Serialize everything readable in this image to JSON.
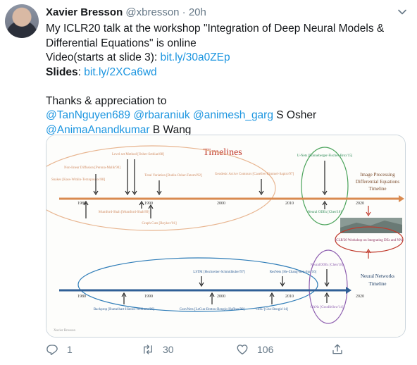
{
  "author": {
    "name": "Xavier Bresson",
    "handle": "@xbresson",
    "time": "20h"
  },
  "tweet": {
    "line1": "My ICLR20 talk at the workshop \"Integration of Deep Neural Models &",
    "line2": "Differential Equations\" is online",
    "video_prefix": "Video(starts at slide 3): ",
    "video_link": "bit.ly/30a0ZEp",
    "slides_label": "Slides",
    "slides_colon": ": ",
    "slides_link": "bit.ly/2XCa6wd",
    "thanks": "Thanks & appreciation to",
    "mention1": "@TanNguyen689",
    "mention2": "@rbaraniuk",
    "mention3": "@animesh_garg",
    "osher": " S Osher",
    "mention4": "@AnimaAnandkumar",
    "wang": " B Wang"
  },
  "slide": {
    "title": "Timelines",
    "top_axis_years": [
      "1980",
      "1990",
      "2000",
      "2010",
      "2020"
    ],
    "bottom_axis_years": [
      "1980",
      "1990",
      "2000",
      "2010",
      "2020"
    ],
    "label_ip": "Image Processing",
    "label_de": "Differential Equations",
    "label_tl": "Timeline",
    "label_nn": "Neural Networks",
    "label_tl2": "Timeline",
    "top_notes": [
      "Level set Method [Osher-Sethian'88]",
      "Non-linear Diffusion [Perona-Malik'90]",
      "Snakes [Kass-Witkin-Terzopoulos'88]",
      "Total Variation [Rudin-Osher-Fatemi'92]",
      "Geodesic Active Contours [Caselles-Kimmel-Sapiro'97]",
      "U-Nets [Ronneberger-Fischer-Brox'15]",
      "Mumford-Shah [Mumford-Shah'89]",
      "Graph Cuts [Boykov'01]",
      "Neural ODEs [Chen'18]",
      "ICLR'20 Workshop on Integrating DEs and NNs"
    ],
    "bottom_notes": [
      "LSTM [Hochreiter-Schmidhuber'97]",
      "ResNets [He-Zhang-Ren-Sun'16]",
      "Backprop [Rumelhart-Hinton-Williams'86]",
      "ConvNets [LeCun-Bottou-Bengio-Haffner'98]",
      "GRU [Cho-Bengio'14]",
      "GANs [Goodfellow'14]",
      "NeuralODEs [Chen'18]"
    ],
    "footer": "Xavier Bresson"
  },
  "actions": {
    "replies": "1",
    "retweets": "30",
    "likes": "106"
  },
  "colors": {
    "link": "#1b95e0",
    "muted": "#657786",
    "orange": "#e8a070",
    "red": "#c9302c",
    "blue": "#2f7db8",
    "purple": "#8e5fb0",
    "green": "#2e8b57"
  },
  "icons": {
    "more": "chevron-down-icon",
    "reply": "reply-icon",
    "retweet": "retweet-icon",
    "like": "heart-icon",
    "share": "share-icon"
  }
}
